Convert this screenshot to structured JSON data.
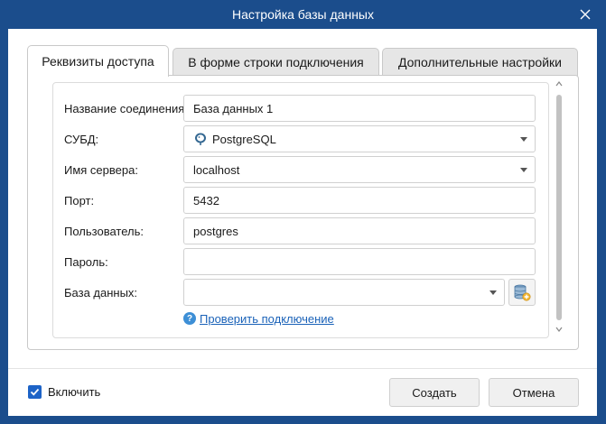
{
  "window": {
    "title": "Настройка базы данных"
  },
  "tabs": [
    {
      "label": "Реквизиты доступа",
      "active": true
    },
    {
      "label": "В форме строки подключения",
      "active": false
    },
    {
      "label": "Дополнительные настройки",
      "active": false
    }
  ],
  "form": {
    "connection_name": {
      "label": "Название соединения:",
      "value": "База данных 1"
    },
    "dbms": {
      "label": "СУБД:",
      "value": "PostgreSQL",
      "icon": "postgresql-icon"
    },
    "server": {
      "label": "Имя сервера:",
      "value": "localhost"
    },
    "port": {
      "label": "Порт:",
      "value": "5432"
    },
    "user": {
      "label": "Пользователь:",
      "value": "postgres"
    },
    "password": {
      "label": "Пароль:",
      "value": ""
    },
    "database": {
      "label": "База данных:",
      "value": ""
    },
    "check_link": "Проверить подключение"
  },
  "footer": {
    "enable_label": "Включить",
    "enable_checked": true,
    "create_label": "Создать",
    "cancel_label": "Отмена"
  },
  "colors": {
    "titlebar": "#1b4d8c",
    "checkbox": "#1d63c7",
    "link": "#1a62b8"
  }
}
